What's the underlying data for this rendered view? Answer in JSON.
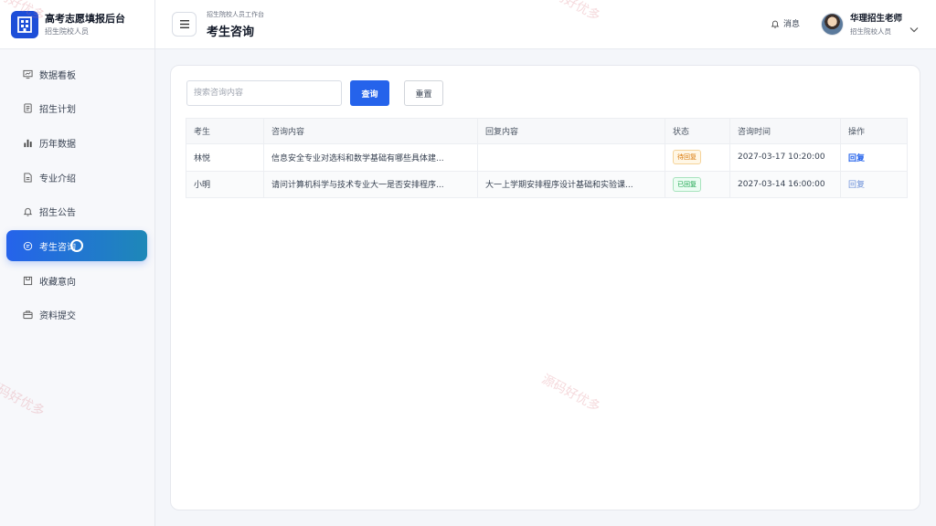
{
  "brand": {
    "title": "高考志愿填报后台",
    "subtitle": "招生院校人员"
  },
  "sidebar": {
    "items": [
      {
        "label": "数据看板",
        "icon": "dashboard-icon"
      },
      {
        "label": "招生计划",
        "icon": "document-icon"
      },
      {
        "label": "历年数据",
        "icon": "bar-chart-icon"
      },
      {
        "label": "专业介绍",
        "icon": "file-icon"
      },
      {
        "label": "招生公告",
        "icon": "bell-icon"
      },
      {
        "label": "考生咨询",
        "icon": "chat-icon"
      },
      {
        "label": "收藏意向",
        "icon": "bookmark-icon"
      },
      {
        "label": "资料提交",
        "icon": "briefcase-icon"
      }
    ],
    "active_index": 5
  },
  "header": {
    "breadcrumb": "招生院校人员工作台",
    "title": "考生咨询",
    "messages_label": "消息",
    "user_name": "华理招生老师",
    "user_role": "招生院校人员"
  },
  "search": {
    "placeholder": "搜索咨询内容",
    "query_label": "查询",
    "reset_label": "重置"
  },
  "table": {
    "columns": [
      "考生",
      "咨询内容",
      "回复内容",
      "状态",
      "咨询时间",
      "操作"
    ],
    "rows": [
      {
        "student": "林悦",
        "question": "信息安全专业对选科和数学基础有哪些具体建...",
        "reply": "",
        "status": "待回复",
        "time": "2027-03-17 10:20:00",
        "action": "回复"
      },
      {
        "student": "小明",
        "question": "请问计算机科学与技术专业大一是否安排程序...",
        "reply": "大一上学期安排程序设计基础和实验课...",
        "status": "已回复",
        "time": "2027-03-14 16:00:00",
        "action": "回复"
      }
    ]
  },
  "watermark": "源码好优多",
  "colors": {
    "primary": "#2563eb",
    "pending": "#d97706",
    "done": "#16a34a"
  }
}
